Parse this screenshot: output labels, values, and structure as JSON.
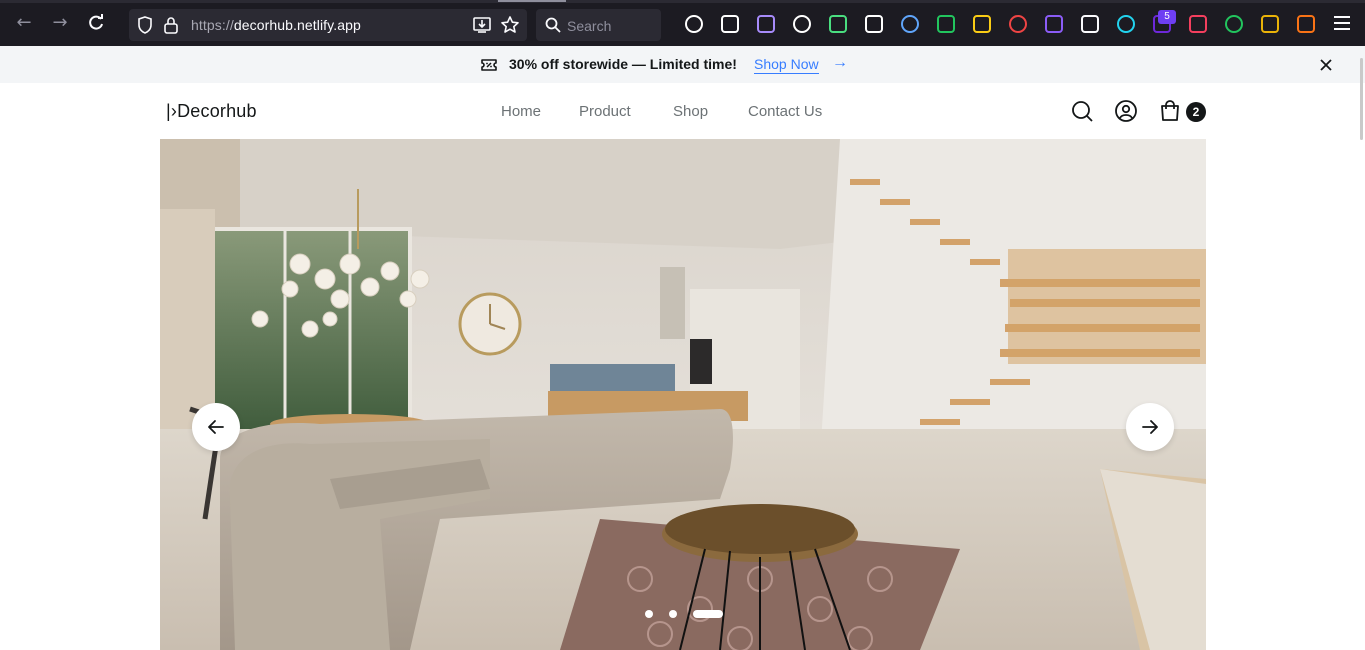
{
  "browser": {
    "url_proto": "https://",
    "url_host": "decorhub.netlify.app",
    "search_placeholder": "Search",
    "ext_badge_count": "5",
    "ext_colors": [
      "#ffffff",
      "#ffffff",
      "#a78bfa",
      "#ffffff",
      "#4ade80",
      "#ffffff",
      "#60a5fa",
      "#22c55e",
      "#facc15",
      "#ef4444",
      "#8b5cf6",
      "#fbfbfe",
      "#22d3ee",
      "#6d28d9",
      "#f43f5e",
      "#22c55e",
      "#eab308",
      "#f97316"
    ]
  },
  "announcement": {
    "message": "30% off storewide — Limited time!",
    "cta": "Shop Now",
    "cta_arrow": "→"
  },
  "header": {
    "logo_mark": "|›",
    "logo_text": "Decorhub",
    "nav": [
      "Home",
      "Product",
      "Shop",
      "Contact Us"
    ],
    "cart_count": "2"
  },
  "hero": {
    "slide_count": 3,
    "active_slide": 3,
    "prev_label": "←",
    "next_label": "→"
  },
  "colors": {
    "text_primary": "#141718",
    "text_secondary": "#6c7275",
    "link_blue": "#377dff",
    "announce_bg": "#f3f5f7",
    "chrome_bg": "#1c1b22"
  }
}
